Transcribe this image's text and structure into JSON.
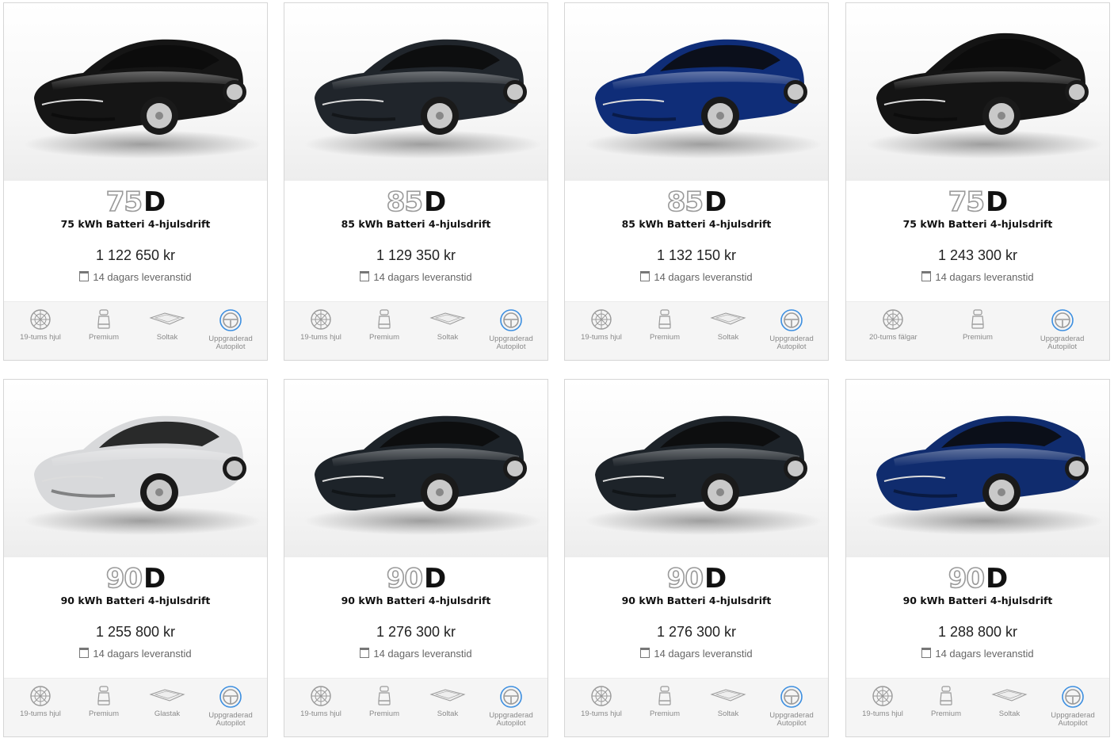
{
  "cards": [
    {
      "badge_num": "75",
      "badge_d": "D",
      "title": "75 kWh Batteri 4-hjulsdrift",
      "price": "1 122 650 kr",
      "delivery": "14 dagars leveranstid",
      "car_color": "#151515",
      "car_model": "model-s",
      "features": [
        {
          "icon": "wheel-icon",
          "label": "19-tums hjul"
        },
        {
          "icon": "seat-icon",
          "label": "Premium"
        },
        {
          "icon": "roof-icon",
          "label": "Soltak"
        },
        {
          "icon": "steering-wheel-icon",
          "label": "Uppgraderad Autopilot"
        }
      ]
    },
    {
      "badge_num": "85",
      "badge_d": "D",
      "title": "85 kWh Batteri 4-hjulsdrift",
      "price": "1 129 350 kr",
      "delivery": "14 dagars leveranstid",
      "car_color": "#20252b",
      "car_model": "model-s",
      "features": [
        {
          "icon": "wheel-icon",
          "label": "19-tums hjul"
        },
        {
          "icon": "seat-icon",
          "label": "Premium"
        },
        {
          "icon": "roof-icon",
          "label": "Soltak"
        },
        {
          "icon": "steering-wheel-icon",
          "label": "Uppgraderad Autopilot"
        }
      ]
    },
    {
      "badge_num": "85",
      "badge_d": "D",
      "title": "85 kWh Batteri 4-hjulsdrift",
      "price": "1 132 150 kr",
      "delivery": "14 dagars leveranstid",
      "car_color": "#0f2d78",
      "car_model": "model-s",
      "features": [
        {
          "icon": "wheel-icon",
          "label": "19-tums hjul"
        },
        {
          "icon": "seat-icon",
          "label": "Premium"
        },
        {
          "icon": "roof-icon",
          "label": "Soltak"
        },
        {
          "icon": "steering-wheel-icon",
          "label": "Uppgraderad Autopilot"
        }
      ]
    },
    {
      "badge_num": "75",
      "badge_d": "D",
      "title": "75 kWh Batteri 4-hjulsdrift",
      "price": "1 243 300 kr",
      "delivery": "14 dagars leveranstid",
      "car_color": "#141414",
      "car_model": "model-x",
      "features": [
        {
          "icon": "wheel-icon",
          "label": "20-tums fälgar"
        },
        {
          "icon": "seat-icon",
          "label": "Premium"
        },
        {
          "icon": "steering-wheel-icon",
          "label": "Uppgraderad Autopilot"
        }
      ]
    },
    {
      "badge_num": "90",
      "badge_d": "D",
      "title": "90 kWh Batteri 4-hjulsdrift",
      "price": "1 255 800 kr",
      "delivery": "14 dagars leveranstid",
      "car_color": "#d8d9db",
      "car_model": "model-s",
      "features": [
        {
          "icon": "wheel-icon",
          "label": "19-tums hjul"
        },
        {
          "icon": "seat-icon",
          "label": "Premium"
        },
        {
          "icon": "roof-icon",
          "label": "Glastak"
        },
        {
          "icon": "steering-wheel-icon",
          "label": "Uppgraderad Autopilot"
        }
      ]
    },
    {
      "badge_num": "90",
      "badge_d": "D",
      "title": "90 kWh Batteri 4-hjulsdrift",
      "price": "1 276 300 kr",
      "delivery": "14 dagars leveranstid",
      "car_color": "#1d2329",
      "car_model": "model-s",
      "features": [
        {
          "icon": "wheel-icon",
          "label": "19-tums hjul"
        },
        {
          "icon": "seat-icon",
          "label": "Premium"
        },
        {
          "icon": "roof-icon",
          "label": "Soltak"
        },
        {
          "icon": "steering-wheel-icon",
          "label": "Uppgraderad Autopilot"
        }
      ]
    },
    {
      "badge_num": "90",
      "badge_d": "D",
      "title": "90 kWh Batteri 4-hjulsdrift",
      "price": "1 276 300 kr",
      "delivery": "14 dagars leveranstid",
      "car_color": "#1d2329",
      "car_model": "model-s",
      "features": [
        {
          "icon": "wheel-icon",
          "label": "19-tums hjul"
        },
        {
          "icon": "seat-icon",
          "label": "Premium"
        },
        {
          "icon": "roof-icon",
          "label": "Soltak"
        },
        {
          "icon": "steering-wheel-icon",
          "label": "Uppgraderad Autopilot"
        }
      ]
    },
    {
      "badge_num": "90",
      "badge_d": "D",
      "title": "90 kWh Batteri 4-hjulsdrift",
      "price": "1 288 800 kr",
      "delivery": "14 dagars leveranstid",
      "car_color": "#102c6e",
      "car_model": "model-s",
      "features": [
        {
          "icon": "wheel-icon",
          "label": "19-tums hjul"
        },
        {
          "icon": "seat-icon",
          "label": "Premium"
        },
        {
          "icon": "roof-icon",
          "label": "Soltak"
        },
        {
          "icon": "steering-wheel-icon",
          "label": "Uppgraderad Autopilot"
        }
      ]
    }
  ],
  "colors": {
    "accent": "#3d8fe0",
    "feature_bg": "#f5f5f5",
    "border": "#d6d6d6"
  }
}
